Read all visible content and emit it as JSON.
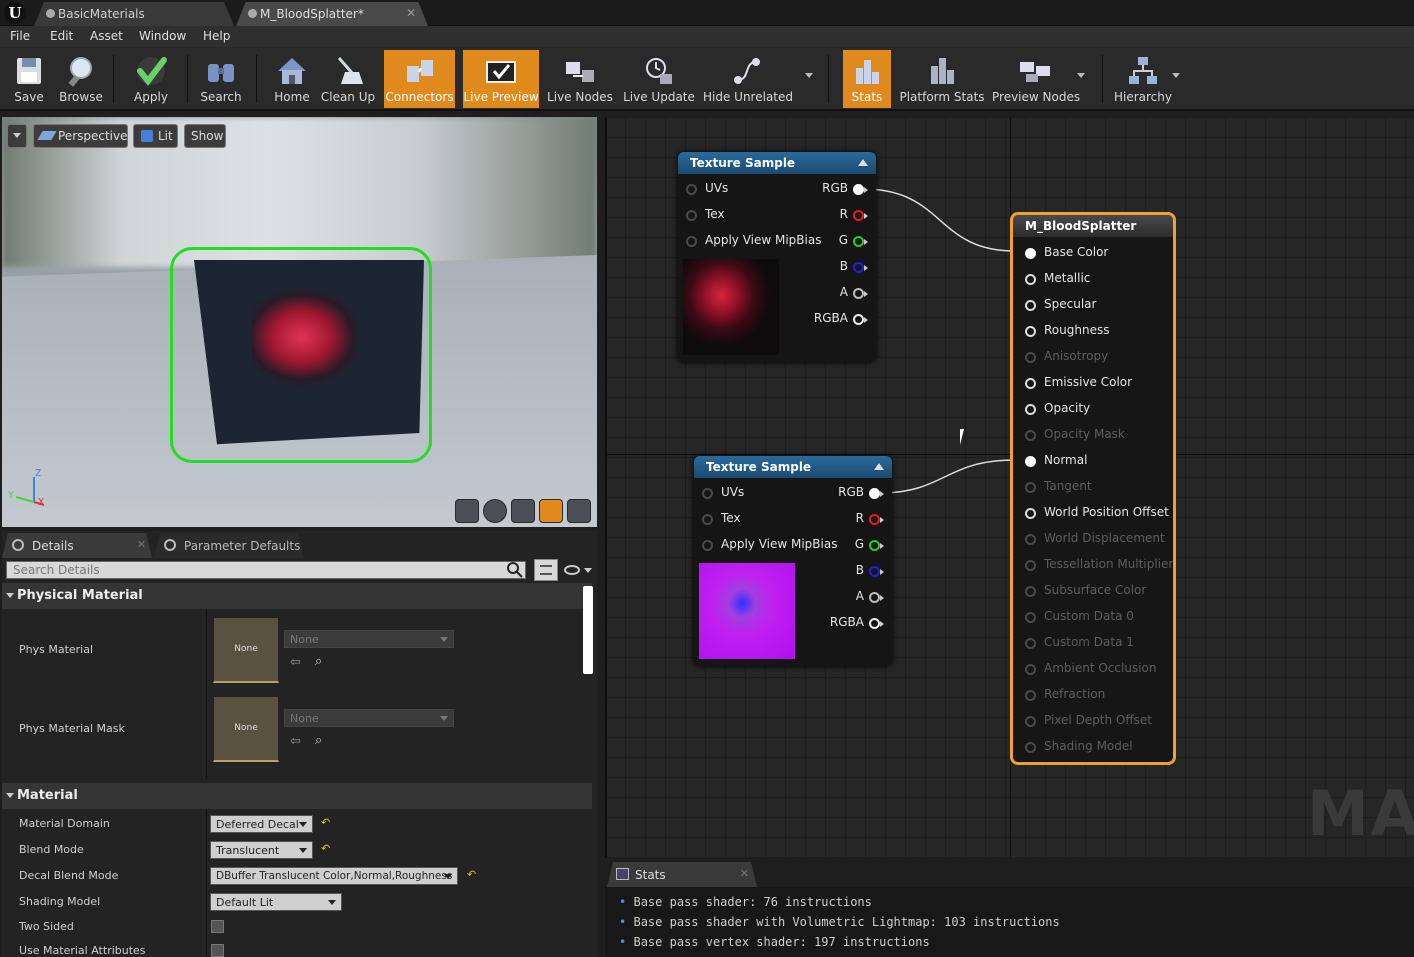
{
  "titlebar": {
    "tabs": [
      {
        "label": "BasicMaterials"
      },
      {
        "label": "M_BloodSplatter*"
      }
    ],
    "logo": "U"
  },
  "menu": [
    "File",
    "Edit",
    "Asset",
    "Window",
    "Help"
  ],
  "toolbar": {
    "buttons": [
      "Save",
      "Browse",
      "Apply",
      "Search",
      "Home",
      "Clean Up",
      "Connectors",
      "Live Preview",
      "Live Nodes",
      "Live Update",
      "Hide Unrelated",
      "Stats",
      "Platform Stats",
      "Preview Nodes",
      "Hierarchy"
    ],
    "active": [
      "Connectors",
      "Live Preview",
      "Stats"
    ]
  },
  "viewport": {
    "perspective": "Perspective",
    "lit": "Lit",
    "show": "Show",
    "axis": {
      "x": "X",
      "y": "Y",
      "z": "Z"
    }
  },
  "details": {
    "tabs": [
      "Details",
      "Parameter Defaults"
    ],
    "search_placeholder": "Search Details",
    "physical_material": {
      "title": "Physical Material",
      "phys_material": "Phys Material",
      "phys_material_mask": "Phys Material Mask",
      "none": "None"
    },
    "material": {
      "title": "Material",
      "rows": [
        {
          "label": "Material Domain",
          "value": "Deferred Decal"
        },
        {
          "label": "Blend Mode",
          "value": "Translucent"
        },
        {
          "label": "Decal Blend Mode",
          "value": "DBuffer Translucent Color,Normal,Roughness"
        },
        {
          "label": "Shading Model",
          "value": "Default Lit"
        },
        {
          "label": "Two Sided",
          "value": ""
        },
        {
          "label": "Use Material Attributes",
          "value": ""
        }
      ]
    }
  },
  "graph": {
    "node1": {
      "title": "Texture Sample",
      "inputs": [
        "UVs",
        "Tex",
        "Apply View MipBias"
      ],
      "outputs": [
        "RGB",
        "R",
        "G",
        "B",
        "A",
        "RGBA"
      ]
    },
    "node2": {
      "title": "Texture Sample",
      "inputs": [
        "UVs",
        "Tex",
        "Apply View MipBias"
      ],
      "outputs": [
        "RGB",
        "R",
        "G",
        "B",
        "A",
        "RGBA"
      ]
    },
    "main": {
      "title": "M_BloodSplatter",
      "pins": [
        {
          "label": "Base Color",
          "enabled": true,
          "connected": true
        },
        {
          "label": "Metallic",
          "enabled": true
        },
        {
          "label": "Specular",
          "enabled": true
        },
        {
          "label": "Roughness",
          "enabled": true
        },
        {
          "label": "Anisotropy",
          "enabled": false
        },
        {
          "label": "Emissive Color",
          "enabled": true
        },
        {
          "label": "Opacity",
          "enabled": true
        },
        {
          "label": "Opacity Mask",
          "enabled": false
        },
        {
          "label": "Normal",
          "enabled": true,
          "connected": true
        },
        {
          "label": "Tangent",
          "enabled": false
        },
        {
          "label": "World Position Offset",
          "enabled": true
        },
        {
          "label": "World Displacement",
          "enabled": false
        },
        {
          "label": "Tessellation Multiplier",
          "enabled": false
        },
        {
          "label": "Subsurface Color",
          "enabled": false
        },
        {
          "label": "Custom Data 0",
          "enabled": false
        },
        {
          "label": "Custom Data 1",
          "enabled": false
        },
        {
          "label": "Ambient Occlusion",
          "enabled": false
        },
        {
          "label": "Refraction",
          "enabled": false
        },
        {
          "label": "Pixel Depth Offset",
          "enabled": false
        },
        {
          "label": "Shading Model",
          "enabled": false
        }
      ]
    },
    "watermark": "MAT"
  },
  "stats": {
    "tab": "Stats",
    "lines": [
      "Base pass shader: 76 instructions",
      "Base pass shader with Volumetric Lightmap: 103 instructions",
      "Base pass vertex shader: 197 instructions"
    ]
  },
  "colors": {
    "accent": "#e08a1e",
    "selection": "#22dd22",
    "node_header": "#2a6a9c"
  }
}
